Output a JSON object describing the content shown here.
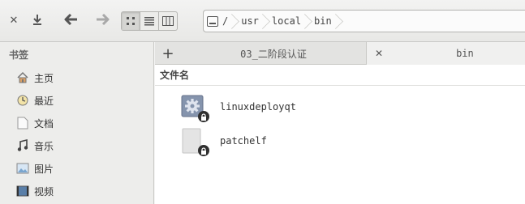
{
  "toolbar": {
    "path": [
      {
        "label": "/"
      },
      {
        "label": "usr"
      },
      {
        "label": "local"
      },
      {
        "label": "bin"
      }
    ]
  },
  "sidebar": {
    "header": "书签",
    "items": [
      {
        "label": "主页",
        "icon": "home-icon"
      },
      {
        "label": "最近",
        "icon": "recent-icon"
      },
      {
        "label": "文档",
        "icon": "document-icon"
      },
      {
        "label": "音乐",
        "icon": "music-icon"
      },
      {
        "label": "图片",
        "icon": "picture-icon"
      },
      {
        "label": "视频",
        "icon": "video-icon"
      }
    ]
  },
  "tabs": [
    {
      "label": "03_二阶段认证"
    },
    {
      "label": "bin"
    }
  ],
  "content": {
    "column_header": "文件名",
    "files": [
      {
        "name": "linuxdeployqt",
        "icon": "executable-gear-icon",
        "locked": true
      },
      {
        "name": "patchelf",
        "icon": "blank-file-icon",
        "locked": true
      }
    ]
  }
}
